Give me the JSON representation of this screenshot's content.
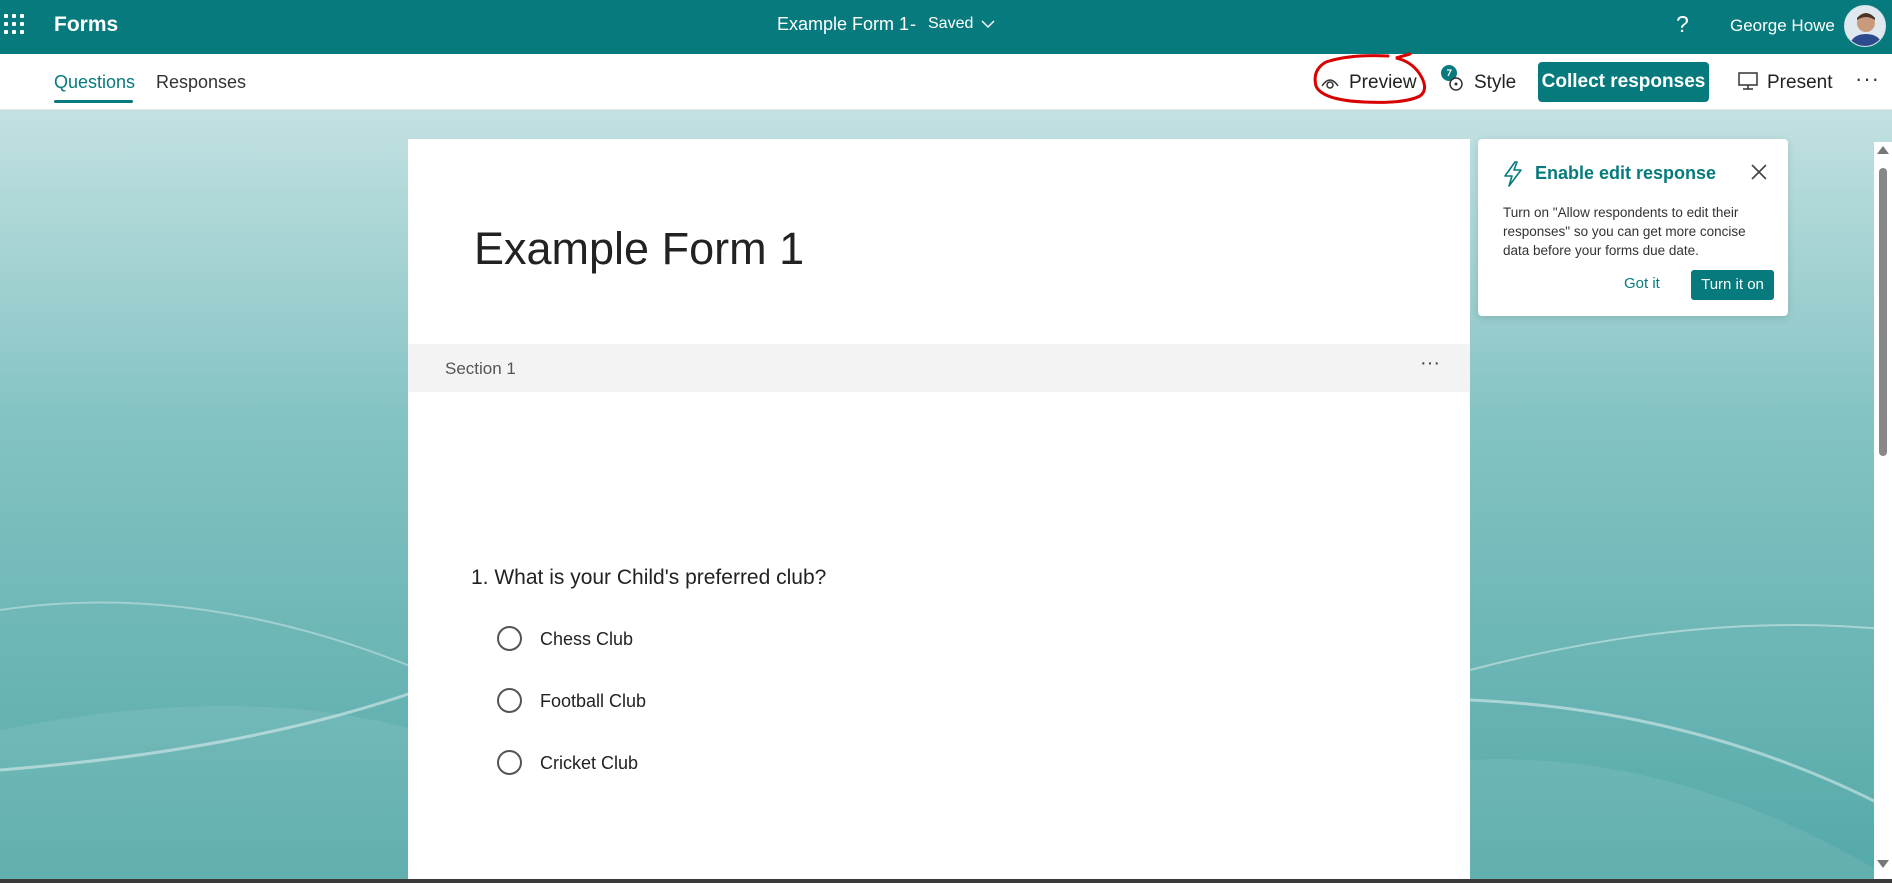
{
  "app": {
    "name": "Forms",
    "doc_title": "Example Form 1",
    "separator": "-",
    "status": "Saved",
    "help": "?",
    "user_name": "George Howe"
  },
  "tabs": [
    {
      "label": "Questions",
      "active": true
    },
    {
      "label": "Responses",
      "active": false
    }
  ],
  "commands": {
    "preview": "Preview",
    "style": "Style",
    "collect": "Collect responses",
    "present": "Present",
    "more": "···"
  },
  "form": {
    "title": "Example Form 1",
    "section_label": "Section 1",
    "section_more": "···",
    "question": "1. What is your Child's preferred club?",
    "options": [
      "Chess Club",
      "Football Club",
      "Cricket Club"
    ]
  },
  "popup": {
    "title": "Enable edit response",
    "body": "Turn on \"Allow respondents to edit their responses\" so you can get more concise data before your forms due date.",
    "got_it": "Got it",
    "turn_on": "Turn it on"
  },
  "colors": {
    "brand": "#077a7d",
    "annotation": "#d90000"
  },
  "icons": [
    "waffle-icon",
    "chevron-down-icon",
    "help-icon",
    "preview-eye-icon",
    "style-palette-icon",
    "present-monitor-icon",
    "more-icon",
    "lightning-icon",
    "close-icon"
  ]
}
